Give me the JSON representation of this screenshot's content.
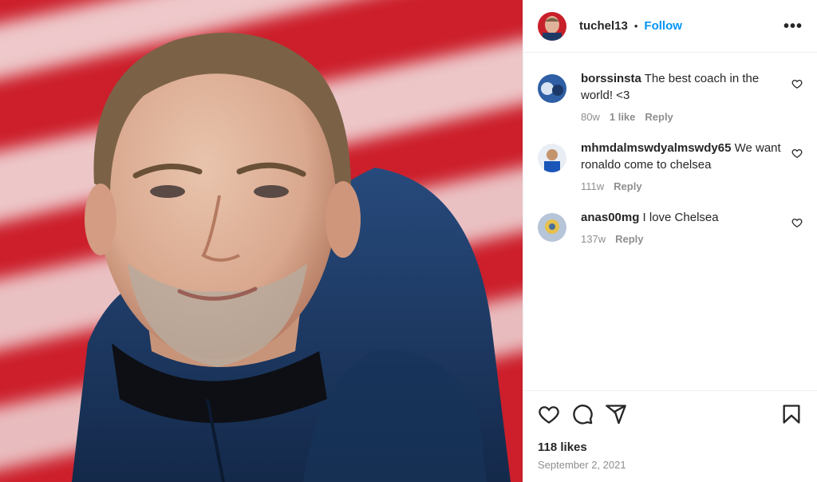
{
  "post": {
    "username": "tuchel13",
    "separator": "•",
    "follow_label": "Follow",
    "more_label": "•••",
    "likes": "118 likes",
    "date": "September 2, 2021"
  },
  "comments": [
    {
      "user": "borssinsta",
      "text": " The best coach in the world! <3",
      "time": "80w",
      "likes": "1 like",
      "reply": "Reply"
    },
    {
      "user": "mhmdalmswdyalmswdy65",
      "text": " We want ronaldo come to chelsea",
      "time": "111w",
      "likes": "",
      "reply": "Reply"
    },
    {
      "user": "anas00mg",
      "text": " I love Chelsea",
      "time": "137w",
      "likes": "",
      "reply": "Reply"
    }
  ],
  "icons": {
    "like": "heart-icon",
    "comment": "comment-icon",
    "share": "share-icon",
    "save": "bookmark-icon",
    "more": "more-icon",
    "comment_like": "heart-icon"
  },
  "colors": {
    "follow": "#0095f6",
    "background_stripes": "#c8202a",
    "jacket": "#1d3a66"
  }
}
